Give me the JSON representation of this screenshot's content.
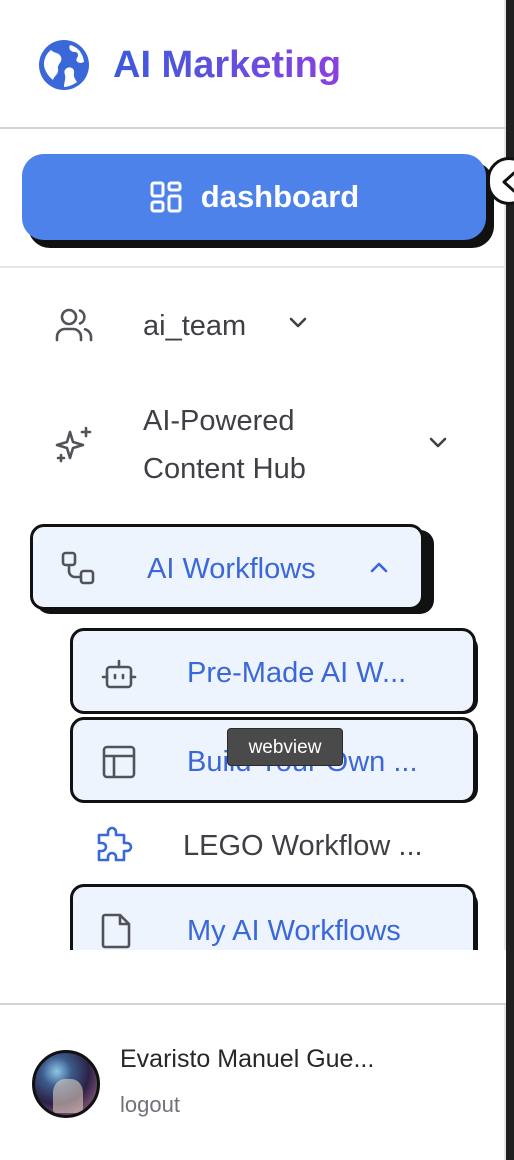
{
  "brand": {
    "title": "AI Marketing",
    "logo_icon": "globe-icon",
    "gradient": [
      "#3b5bdb",
      "#8b3fe0"
    ]
  },
  "dashboard": {
    "label": "dashboard",
    "icon": "layout-grid-icon",
    "color": "#4d82ea"
  },
  "nav": {
    "ai_team": {
      "label": "ai_team",
      "icon": "users-icon",
      "expanded": false
    },
    "content_hub": {
      "label_line1": "AI-Powered",
      "label_line2": "Content Hub",
      "icon": "sparkles-icon",
      "expanded": false
    },
    "ai_workflows": {
      "label": "AI Workflows",
      "icon": "workflow-icon",
      "expanded": true,
      "children": [
        {
          "label": "Pre-Made AI W...",
          "icon": "bot-icon",
          "active_style": true
        },
        {
          "label": "Build Your Own ...",
          "icon": "layout-template-icon",
          "active_style": true
        },
        {
          "label": "LEGO Workflow ...",
          "icon": "puzzle-icon",
          "active_style": false
        },
        {
          "label": "My AI Workflows",
          "icon": "file-icon",
          "active_style": true
        }
      ]
    }
  },
  "tooltip": {
    "text": "webview"
  },
  "user": {
    "name": "Evaristo Manuel Gue...",
    "logout_label": "logout"
  },
  "colors": {
    "accent": "#4d82ea",
    "sub_text": "#3b68d9",
    "sub_bg": "#eef4fd"
  }
}
